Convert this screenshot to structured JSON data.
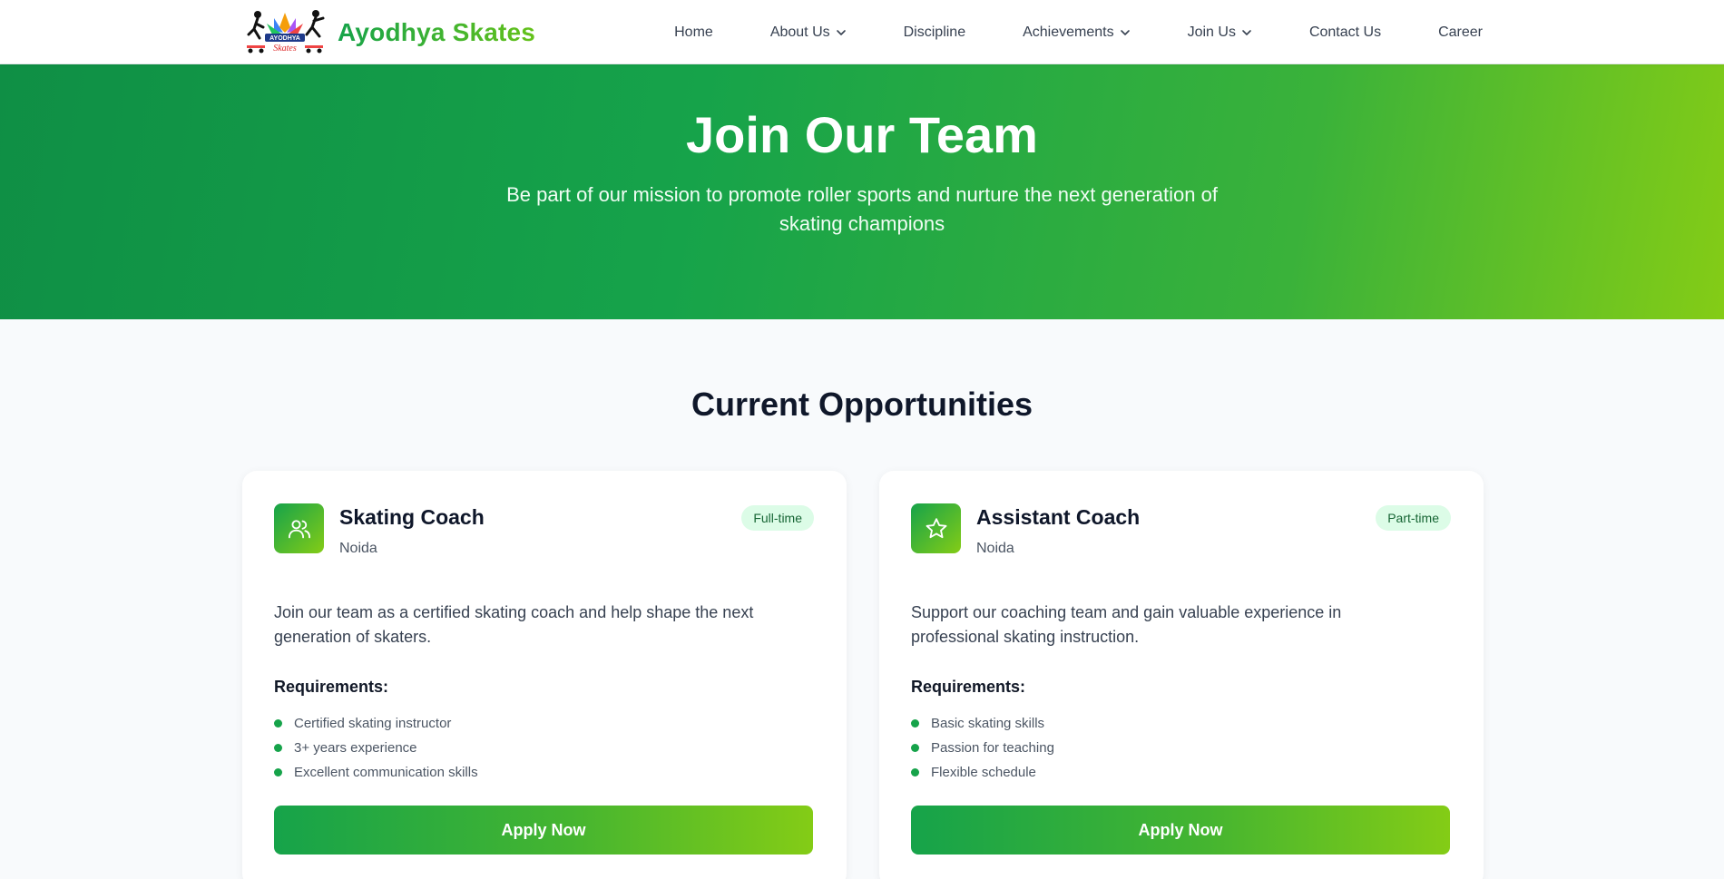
{
  "brand": {
    "name": "Ayodhya Skates",
    "logo_text": "AYODHYA",
    "logo_script": "Skates"
  },
  "nav": {
    "items": [
      {
        "label": "Home",
        "has_dropdown": false
      },
      {
        "label": "About Us",
        "has_dropdown": true
      },
      {
        "label": "Discipline",
        "has_dropdown": false
      },
      {
        "label": "Achievements",
        "has_dropdown": true
      },
      {
        "label": "Join Us",
        "has_dropdown": true
      },
      {
        "label": "Contact Us",
        "has_dropdown": false
      },
      {
        "label": "Career",
        "has_dropdown": false
      }
    ]
  },
  "hero": {
    "title": "Join Our Team",
    "subtitle": "Be part of our mission to promote roller sports and nurture the next generation of skating champions"
  },
  "opportunities": {
    "title": "Current Opportunities",
    "requirements_label": "Requirements:",
    "jobs": [
      {
        "icon": "users-icon",
        "title": "Skating Coach",
        "location": "Noida",
        "type": "Full-time",
        "description": "Join our team as a certified skating coach and help shape the next generation of skaters.",
        "requirements": [
          "Certified skating instructor",
          "3+ years experience",
          "Excellent communication skills"
        ],
        "apply_label": "Apply Now"
      },
      {
        "icon": "star-icon",
        "title": "Assistant Coach",
        "location": "Noida",
        "type": "Part-time",
        "description": "Support our coaching team and gain valuable experience in professional skating instruction.",
        "requirements": [
          "Basic skating skills",
          "Passion for teaching",
          "Flexible schedule"
        ],
        "apply_label": "Apply Now"
      }
    ]
  },
  "colors": {
    "primary": "#16a34a",
    "accent": "#84cc16",
    "badge_bg": "#dcfce7",
    "badge_text": "#166534",
    "page_bg": "#f8fafc"
  }
}
